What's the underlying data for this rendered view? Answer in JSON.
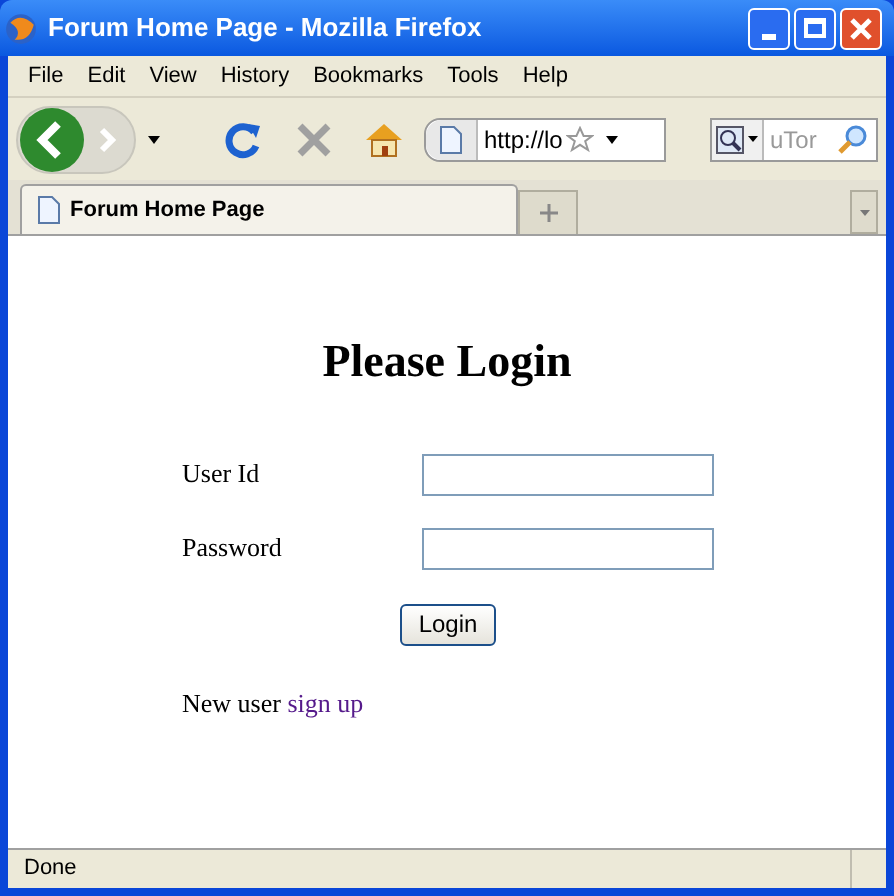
{
  "window": {
    "title": "Forum Home Page - Mozilla Firefox"
  },
  "menu": [
    "File",
    "Edit",
    "View",
    "History",
    "Bookmarks",
    "Tools",
    "Help"
  ],
  "toolbar": {
    "url": "http://lo",
    "search_placeholder": "uTor"
  },
  "tabs": [
    {
      "label": "Forum Home Page",
      "selected": true
    }
  ],
  "page": {
    "heading": "Please Login",
    "fields": [
      {
        "label": "User Id"
      },
      {
        "label": "Password"
      }
    ],
    "button": "Login",
    "signup_text": "New user",
    "signup_link": "sign up"
  },
  "status_bar": "Done"
}
